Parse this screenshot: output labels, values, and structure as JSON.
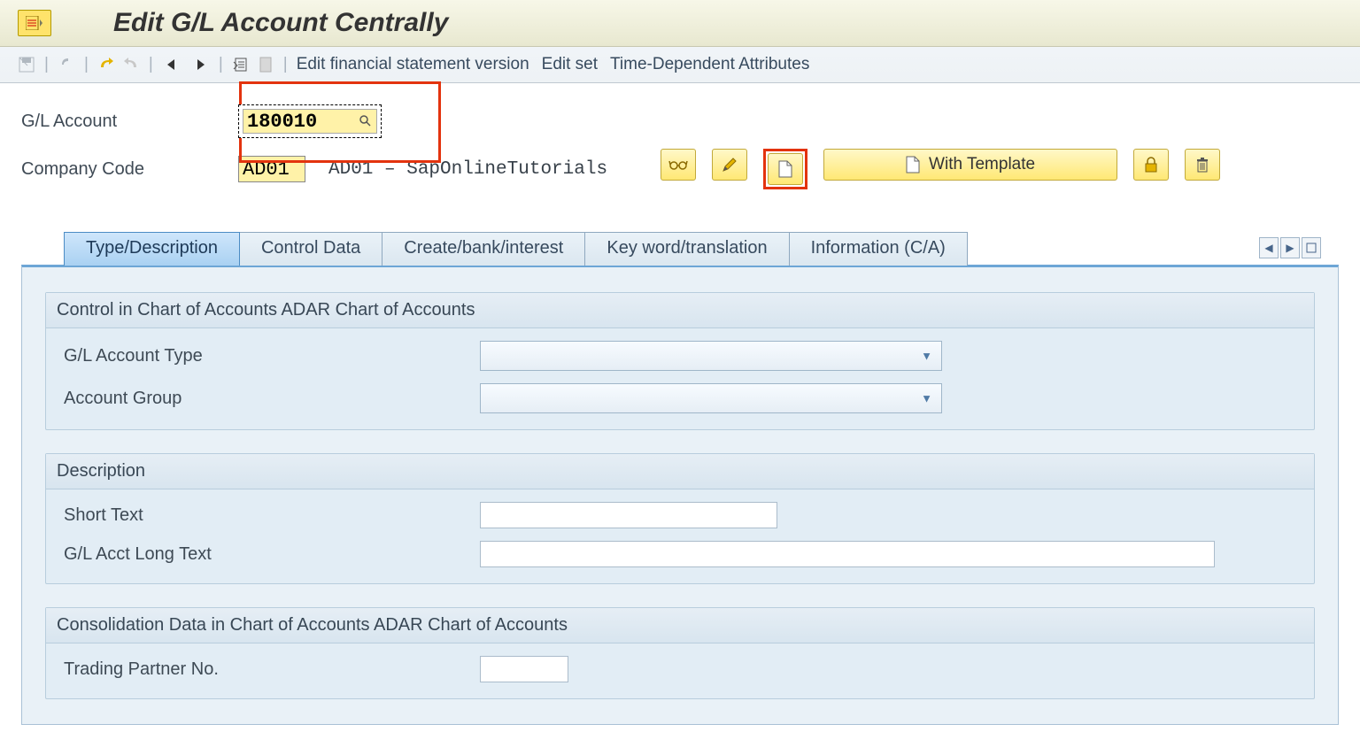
{
  "header": {
    "title": "Edit G/L Account Centrally"
  },
  "toolbar": {
    "links": {
      "fsv": "Edit financial statement version",
      "editset": "Edit set",
      "tdattr": "Time-Dependent Attributes"
    }
  },
  "selection": {
    "gl_label": "G/L Account",
    "gl_value": "180010",
    "cc_label": "Company Code",
    "cc_value": "AD01",
    "cc_desc": "AD01 – SapOnlineTutorials"
  },
  "actions": {
    "with_template": "With Template"
  },
  "tabs": {
    "type_desc": "Type/Description",
    "control": "Control Data",
    "bank": "Create/bank/interest",
    "keyword": "Key word/translation",
    "info": "Information (C/A)"
  },
  "groups": {
    "g1": {
      "title": "Control in Chart of Accounts ADAR Chart of Accounts",
      "acct_type_label": "G/L Account Type",
      "acct_type_value": "",
      "acct_group_label": "Account Group",
      "acct_group_value": ""
    },
    "g2": {
      "title": "Description",
      "short_label": "Short Text",
      "short_value": "",
      "long_label": "G/L Acct Long Text",
      "long_value": ""
    },
    "g3": {
      "title": "Consolidation Data in Chart of Accounts ADAR Chart of Accounts",
      "trading_label": "Trading Partner No.",
      "trading_value": ""
    }
  }
}
